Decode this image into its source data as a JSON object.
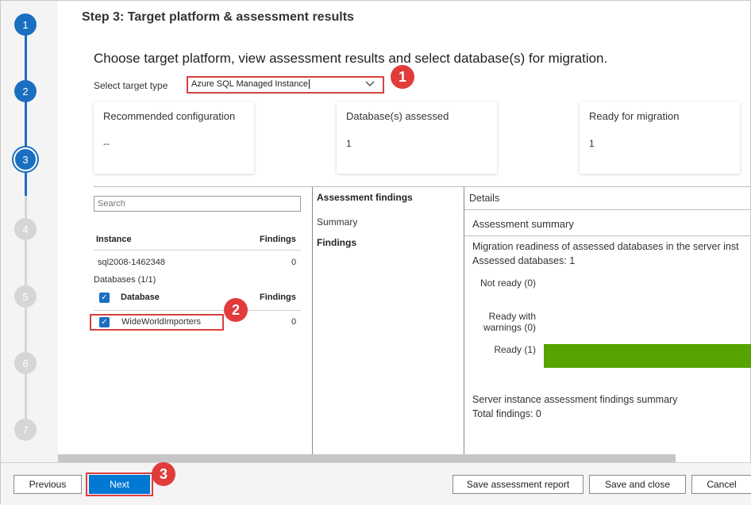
{
  "stepper": {
    "steps": [
      {
        "num": "1",
        "state": "done"
      },
      {
        "num": "2",
        "state": "done"
      },
      {
        "num": "3",
        "state": "current"
      },
      {
        "num": "4",
        "state": "todo"
      },
      {
        "num": "5",
        "state": "todo"
      },
      {
        "num": "6",
        "state": "todo"
      },
      {
        "num": "7",
        "state": "todo"
      }
    ]
  },
  "header": {
    "step_title": "Step 3: Target platform & assessment results",
    "subtitle": "Choose target platform, view assessment results and select database(s) for migration."
  },
  "target": {
    "label": "Select target type",
    "selected": "Azure SQL Managed Instance"
  },
  "badges": [
    "1",
    "2",
    "3"
  ],
  "cards": [
    {
      "title": "Recommended configuration",
      "value": "--"
    },
    {
      "title": "Database(s) assessed",
      "value": "1"
    },
    {
      "title": "Ready for migration",
      "value": "1"
    }
  ],
  "left_panel": {
    "search_placeholder": "Search",
    "instance_header": "Instance",
    "findings_header": "Findings",
    "instance_name": "sql2008-1462348",
    "instance_findings": "0",
    "databases_label": "Databases (1/1)",
    "database_header": "Database",
    "db_findings_header": "Findings",
    "db_name": "WideWorldImporters",
    "db_findings": "0"
  },
  "mid_panel": {
    "title": "Assessment findings",
    "summary": "Summary",
    "findings": "Findings"
  },
  "details": {
    "header": "Details",
    "summary_header": "Assessment summary",
    "readiness_text": "Migration readiness of assessed databases in the server inst",
    "assessed_text": "Assessed databases: 1",
    "not_ready": "Not ready (0)",
    "ready_with_warnings_1": "Ready with",
    "ready_with_warnings_2": "warnings (0)",
    "ready": "Ready (1)",
    "findings_summary": "Server instance assessment findings summary",
    "total_findings": "Total findings: 0",
    "bar_color": "#57a300"
  },
  "footer": {
    "previous": "Previous",
    "next": "Next",
    "save_report": "Save assessment report",
    "save_close": "Save and close",
    "cancel": "Cancel"
  }
}
